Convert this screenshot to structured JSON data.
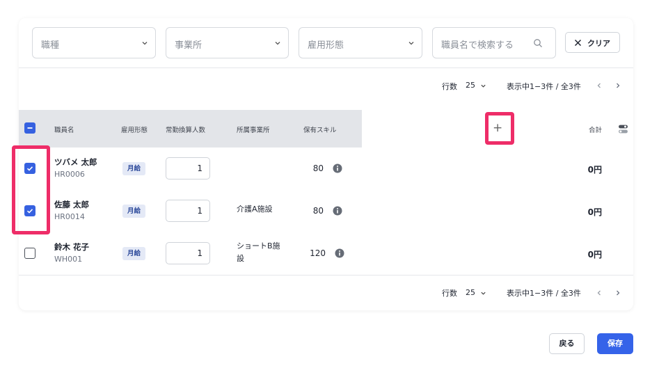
{
  "filters": {
    "job_type_placeholder": "職種",
    "office_placeholder": "事業所",
    "employment_placeholder": "雇用形態",
    "search_placeholder": "職員名で検索する",
    "clear_label": "クリア"
  },
  "pager": {
    "rows_label": "行数",
    "rows_value": "25",
    "range_text": "表示中1−3件 / 全3件"
  },
  "table": {
    "columns": {
      "name": "職員名",
      "employment": "雇用形態",
      "fte": "常勤換算人数",
      "office": "所属事業所",
      "skills": "保有スキル",
      "add": "+",
      "total": "合計"
    },
    "rows": [
      {
        "checked": true,
        "name": "ツバメ 太郎",
        "code": "HR0006",
        "employment": "月給",
        "fte": "1",
        "office": "",
        "skill": "80",
        "total": "0円"
      },
      {
        "checked": true,
        "name": "佐藤 太郎",
        "code": "HR0014",
        "employment": "月給",
        "fte": "1",
        "office": "介護A施設",
        "skill": "80",
        "total": "0円"
      },
      {
        "checked": false,
        "name": "鈴木 花子",
        "code": "WH001",
        "employment": "月給",
        "fte": "1",
        "office": "ショートB施設",
        "skill": "120",
        "total": "0円"
      }
    ]
  },
  "footer": {
    "back_label": "戻る",
    "save_label": "保存"
  },
  "colors": {
    "accent": "#3563e9",
    "highlight": "#ee2d68"
  }
}
